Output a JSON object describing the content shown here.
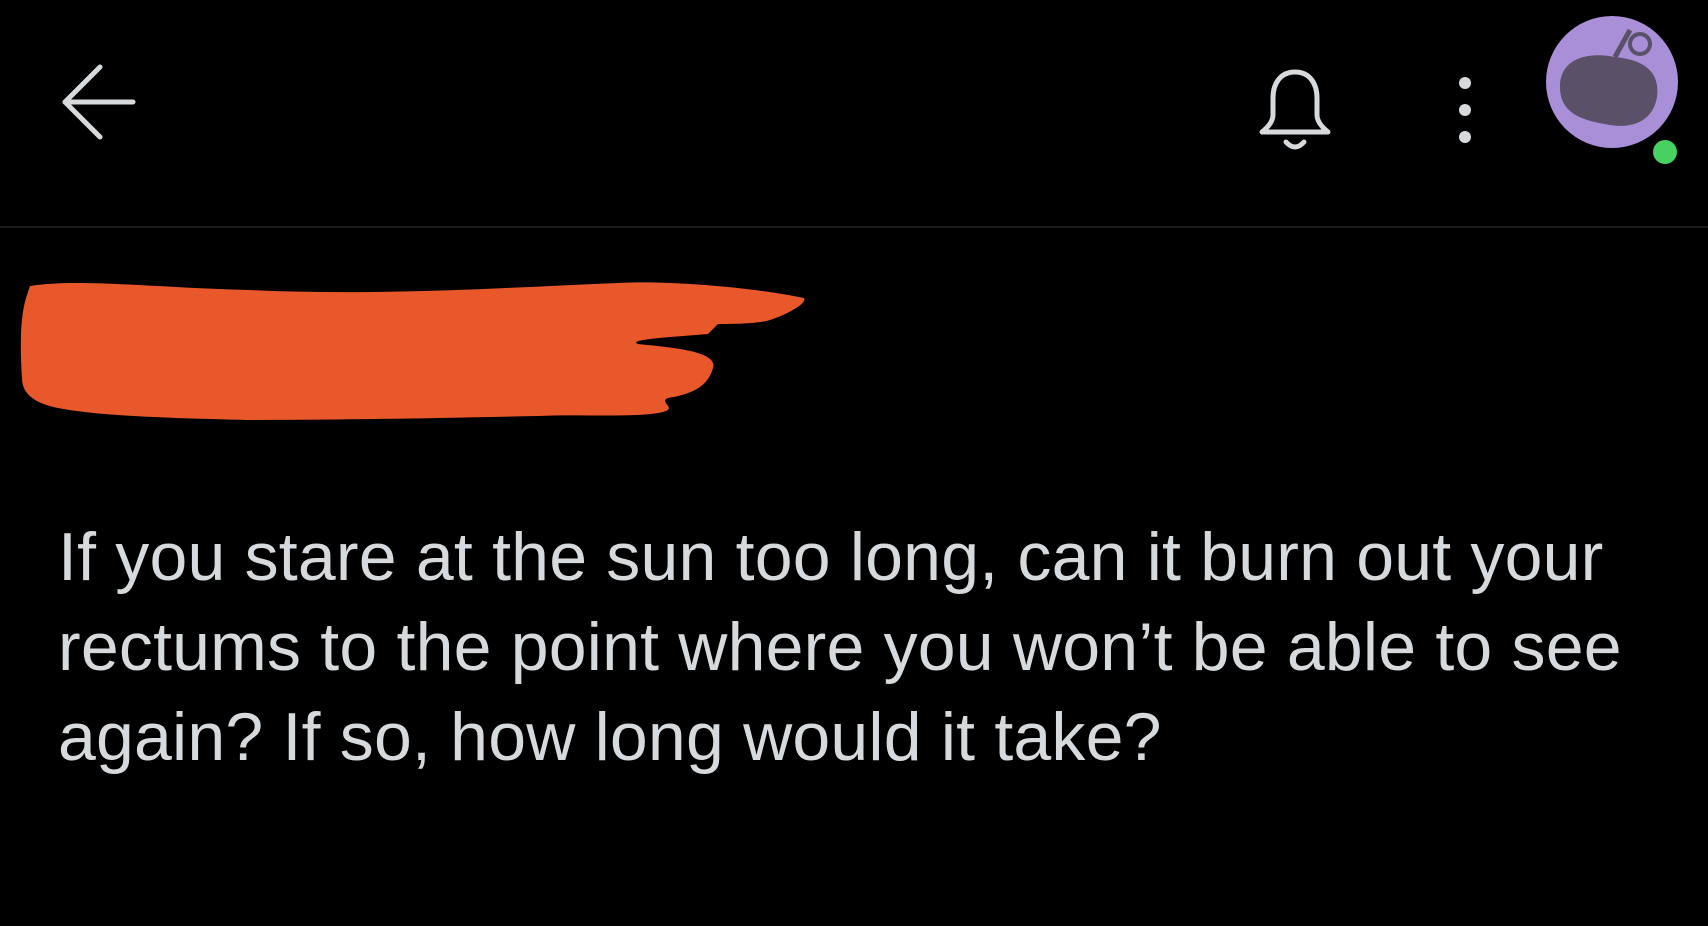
{
  "header": {
    "back_icon": "arrow-left-icon",
    "notification_icon": "bell-icon",
    "more_icon": "vertical-dots-icon",
    "avatar_icon": "snoo-avatar-icon",
    "online_status_color": "#46d160",
    "avatar_color": "#a88fd8"
  },
  "post": {
    "author_redaction_color": "#e8582a",
    "title": "If you stare at the sun too long, can it burn out your rectums to the point where you won’t be able to see again? If so, how long would it take?"
  },
  "theme": {
    "background": "#000000",
    "text": "#d7dadc"
  }
}
